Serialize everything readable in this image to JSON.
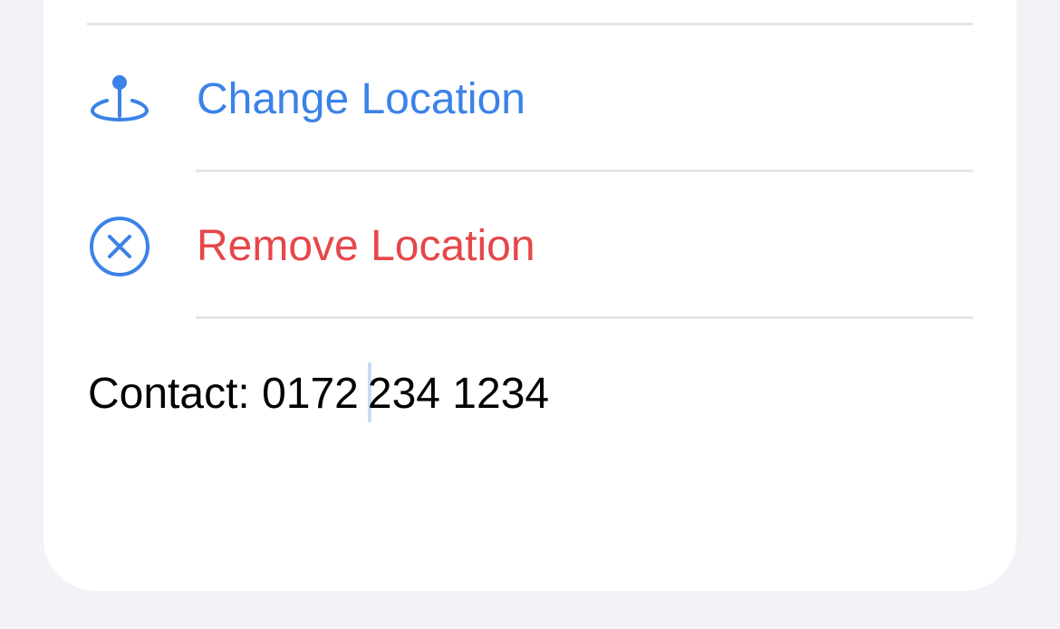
{
  "menu": {
    "change_location": {
      "label": "Change Location",
      "icon": "location-pin-icon"
    },
    "remove_location": {
      "label": "Remove Location",
      "icon": "circle-x-icon"
    }
  },
  "contact": {
    "prefix": "Contact: 0172",
    "suffix": "234 1234"
  },
  "colors": {
    "accent": "#3b82e8",
    "destructive": "#e5474a",
    "background": "#f2f2f7",
    "card": "#ffffff",
    "divider": "#e5e5ea"
  }
}
